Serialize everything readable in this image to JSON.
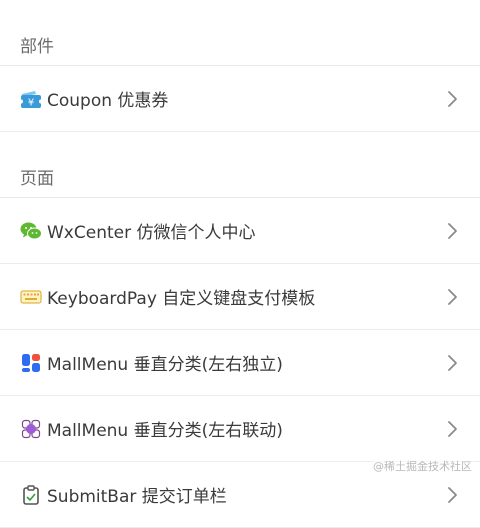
{
  "sections": [
    {
      "header": "部件",
      "items": [
        {
          "label": "Coupon 优惠券",
          "icon": "coupon-ticket-icon"
        }
      ]
    },
    {
      "header": "页面",
      "items": [
        {
          "label": "WxCenter 仿微信个人中心",
          "icon": "wechat-icon"
        },
        {
          "label": "KeyboardPay 自定义键盘支付模板",
          "icon": "keyboard-icon"
        },
        {
          "label": "MallMenu 垂直分类(左右独立)",
          "icon": "blocks-grid-icon"
        },
        {
          "label": "MallMenu 垂直分类(左右联动)",
          "icon": "flower-grid-icon"
        },
        {
          "label": "SubmitBar 提交订单栏",
          "icon": "clipboard-icon"
        }
      ]
    }
  ],
  "watermark": "@稀土掘金技术社区",
  "colors": {
    "wechat_green": "#5fb832",
    "blue_blocks": "#2f6cf0",
    "purple_flower": "#a05bd8",
    "coupon_blue": "#3a9ad9",
    "keyboard_yellow": "#f2c542"
  }
}
